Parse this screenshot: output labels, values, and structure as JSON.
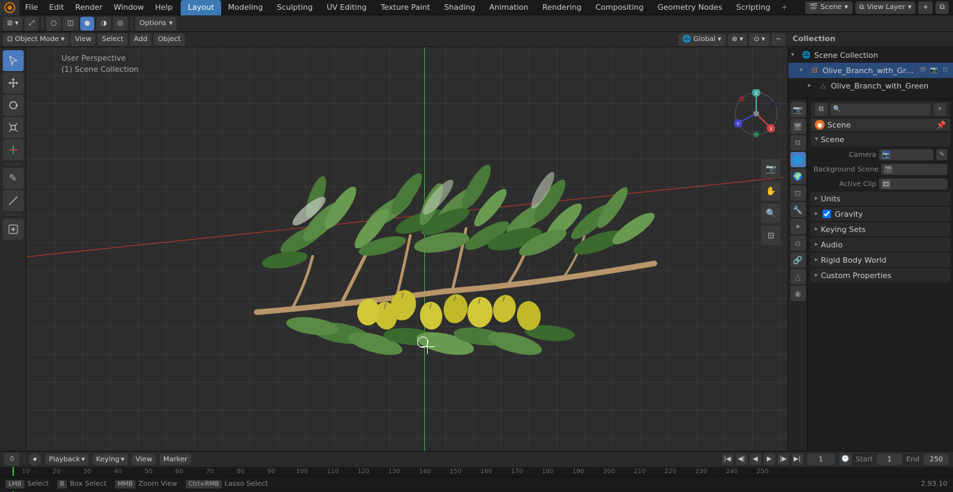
{
  "app": {
    "title": "Blender"
  },
  "top_menu": {
    "items": [
      "File",
      "Edit",
      "Render",
      "Window",
      "Help"
    ]
  },
  "workspace_tabs": {
    "tabs": [
      "Layout",
      "Modeling",
      "Sculpting",
      "UV Editing",
      "Texture Paint",
      "Shading",
      "Animation",
      "Rendering",
      "Compositing",
      "Geometry Nodes",
      "Scripting"
    ],
    "active": "Layout"
  },
  "top_right": {
    "scene_label": "Scene",
    "view_layer_label": "View Layer",
    "options_label": "Options"
  },
  "header": {
    "mode_label": "Object Mode",
    "view_label": "View",
    "select_label": "Select",
    "add_label": "Add",
    "object_label": "Object",
    "transform_label": "Global",
    "pivot_label": "Individual Origins"
  },
  "viewport": {
    "perspective_label": "User Perspective",
    "collection_label": "(1) Scene Collection"
  },
  "outliner": {
    "title": "Collection",
    "items": [
      {
        "name": "Olive_Branch_with_Green_Oli",
        "type": "collection",
        "indent": 0,
        "expanded": true
      },
      {
        "name": "Olive_Branch_with_Green",
        "type": "mesh",
        "indent": 1,
        "expanded": false
      }
    ]
  },
  "properties": {
    "active_tab": "scene",
    "scene_section": {
      "title": "Scene",
      "camera_label": "Camera",
      "camera_value": "",
      "bg_scene_label": "Background Scene",
      "active_clip_label": "Active Clip"
    },
    "sections": [
      {
        "label": "Units",
        "expanded": false
      },
      {
        "label": "Gravity",
        "expanded": false,
        "checked": true
      },
      {
        "label": "Keying Sets",
        "expanded": false
      },
      {
        "label": "Audio",
        "expanded": false
      },
      {
        "label": "Rigid Body World",
        "expanded": false
      },
      {
        "label": "Custom Properties",
        "expanded": false
      }
    ]
  },
  "timeline": {
    "playback_label": "Playback",
    "keying_label": "Keying",
    "view_label": "View",
    "marker_label": "Marker",
    "frame_current": "1",
    "start_label": "Start",
    "start_value": "1",
    "end_label": "End",
    "end_value": "250",
    "frame_numbers": [
      "10",
      "20",
      "30",
      "40",
      "50",
      "60",
      "70",
      "80",
      "90",
      "100",
      "110",
      "120",
      "130",
      "140",
      "150",
      "160",
      "170",
      "180",
      "190",
      "200",
      "210",
      "220",
      "230",
      "240",
      "250"
    ]
  },
  "status_bar": {
    "select_label": "Select",
    "box_select_label": "Box Select",
    "zoom_view_label": "Zoom View",
    "lasso_select_label": "Lasso Select",
    "version": "2.93.10"
  },
  "icons": {
    "blender": "⬡",
    "cursor": "⊕",
    "move": "↔",
    "rotate": "↻",
    "scale": "⤢",
    "transform": "⤡",
    "annotate": "✎",
    "measure": "📏",
    "grab": "✋",
    "camera": "📷",
    "render": "🎬",
    "material": "🔮",
    "scene": "🌐",
    "world": "🌍",
    "filter": "⊟",
    "expand": "▾",
    "collapse": "▸"
  }
}
